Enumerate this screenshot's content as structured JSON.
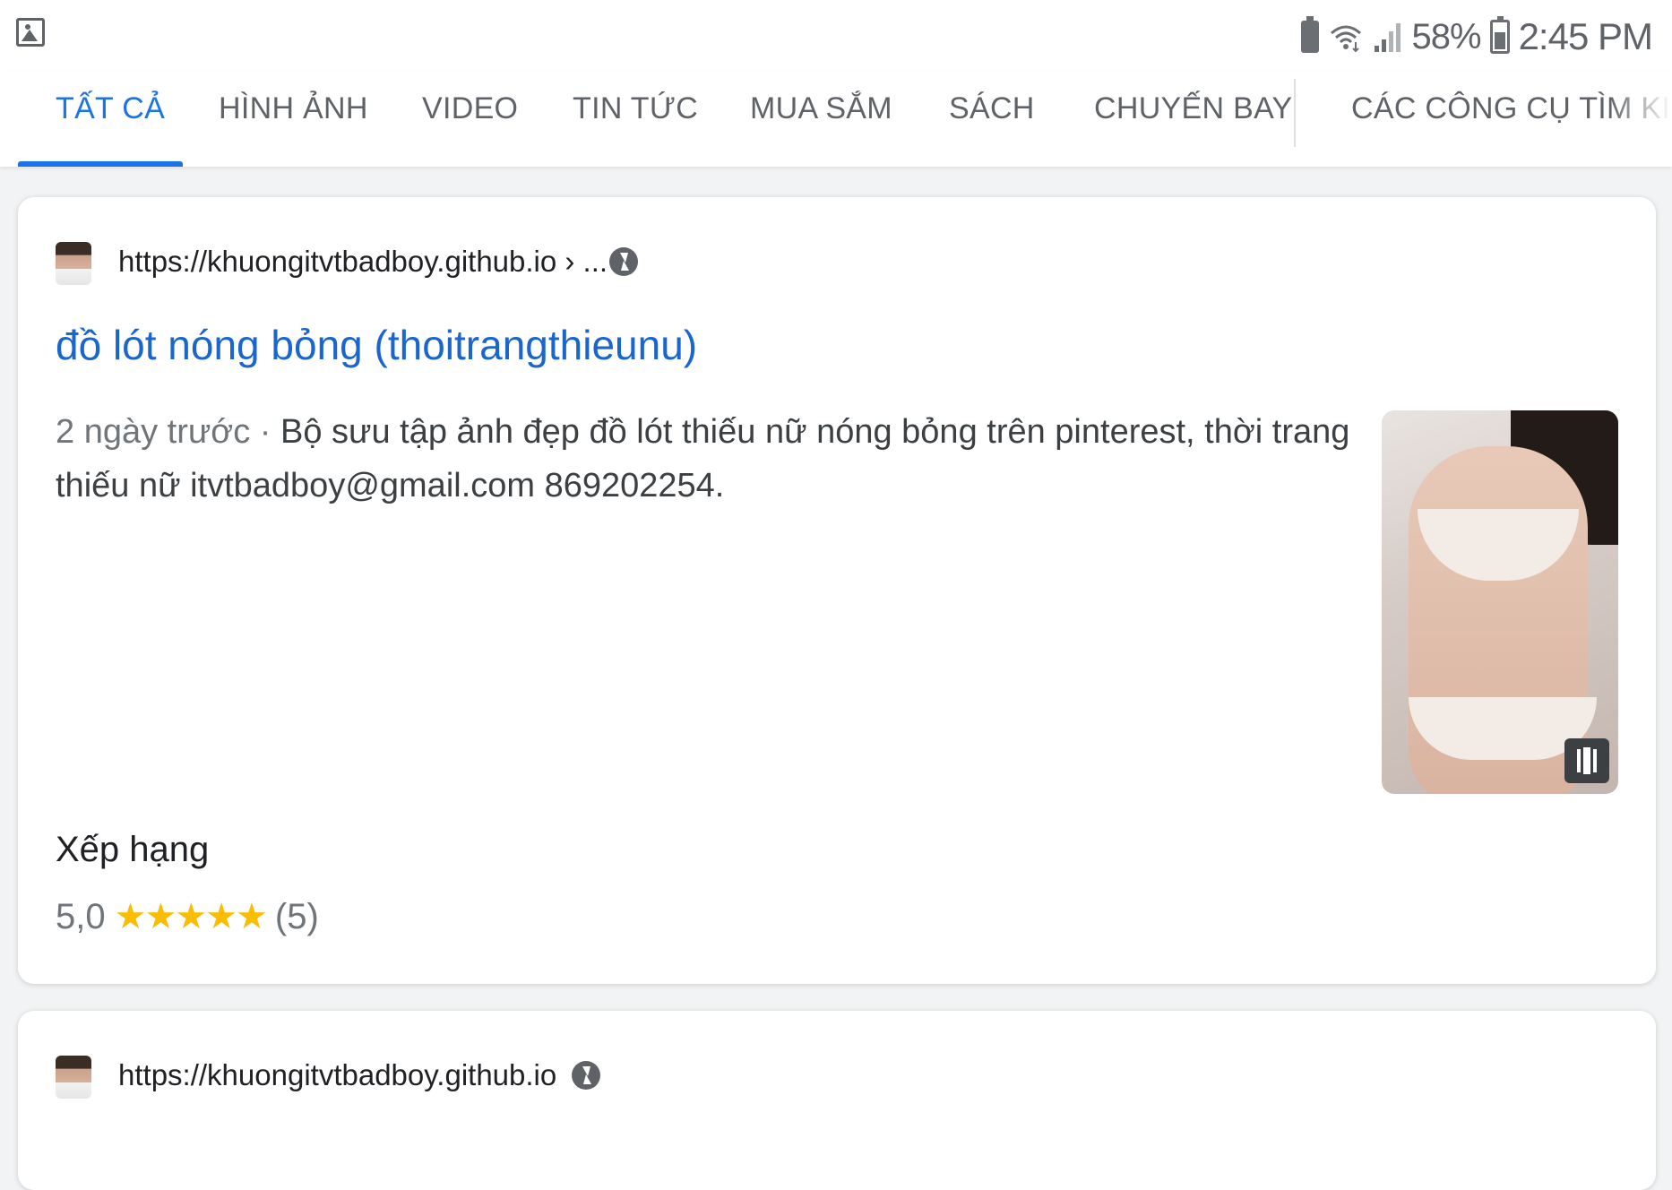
{
  "status_bar": {
    "battery_percent": "58%",
    "time": "2:45 PM"
  },
  "tabs": [
    {
      "label": "TẤT CẢ",
      "active": true
    },
    {
      "label": "HÌNH ẢNH",
      "active": false
    },
    {
      "label": "VIDEO",
      "active": false
    },
    {
      "label": "TIN TỨC",
      "active": false
    },
    {
      "label": "MUA SẮM",
      "active": false
    },
    {
      "label": "SÁCH",
      "active": false
    },
    {
      "label": "CHUYẾN BAY",
      "active": false
    },
    {
      "label": "CÁC CÔNG CỤ TÌM KIẾM",
      "active": false
    }
  ],
  "results": [
    {
      "url": "https://khuongitvtbadboy.github.io › ...",
      "title": "đồ lót nóng bỏng (thoitrangthieunu)",
      "date": "2 ngày trước · ",
      "snippet": "Bộ sưu tập ảnh đẹp đồ lót thiếu nữ nóng bỏng trên pinterest, thời trang thiếu nữ itvtbadboy@gmail.com 869202254.",
      "rating_label": "Xếp hạng",
      "rating_value": "5,0",
      "stars": "★★★★★",
      "rating_count": "(5)"
    },
    {
      "url": "https://khuongitvtbadboy.github.io"
    }
  ],
  "colors": {
    "accent": "#1a73e8",
    "link": "#1a66cc",
    "star": "#fbbc04"
  }
}
